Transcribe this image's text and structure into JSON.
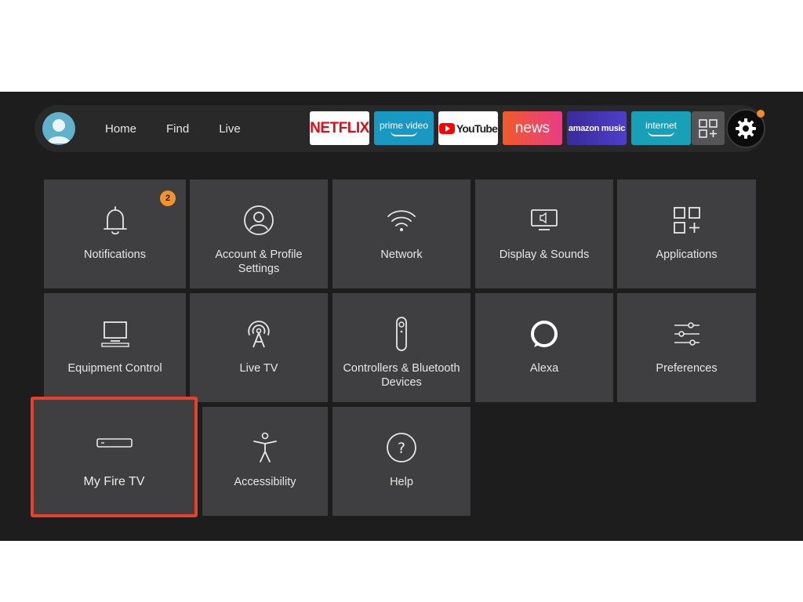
{
  "nav": {
    "links": [
      "Home",
      "Find",
      "Live"
    ],
    "apps": {
      "netflix": "NETFLIX",
      "prime": "prime video",
      "youtube": "YouTube",
      "news": "news",
      "music": "amazon music",
      "internet": "internet"
    }
  },
  "tiles": {
    "notifications": {
      "label": "Notifications",
      "badge": "2"
    },
    "account": {
      "label": "Account & Profile Settings"
    },
    "network": {
      "label": "Network"
    },
    "display": {
      "label": "Display & Sounds"
    },
    "applications": {
      "label": "Applications"
    },
    "equipment": {
      "label": "Equipment Control"
    },
    "livetv": {
      "label": "Live TV"
    },
    "controllers": {
      "label": "Controllers & Bluetooth Devices"
    },
    "alexa": {
      "label": "Alexa"
    },
    "preferences": {
      "label": "Preferences"
    },
    "myfiretv": {
      "label": "My Fire TV"
    },
    "accessibility": {
      "label": "Accessibility"
    },
    "help": {
      "label": "Help"
    }
  },
  "colors": {
    "focus_outline": "#e8402a",
    "badge": "#f0932b",
    "tile_bg": "#3f3f41"
  }
}
